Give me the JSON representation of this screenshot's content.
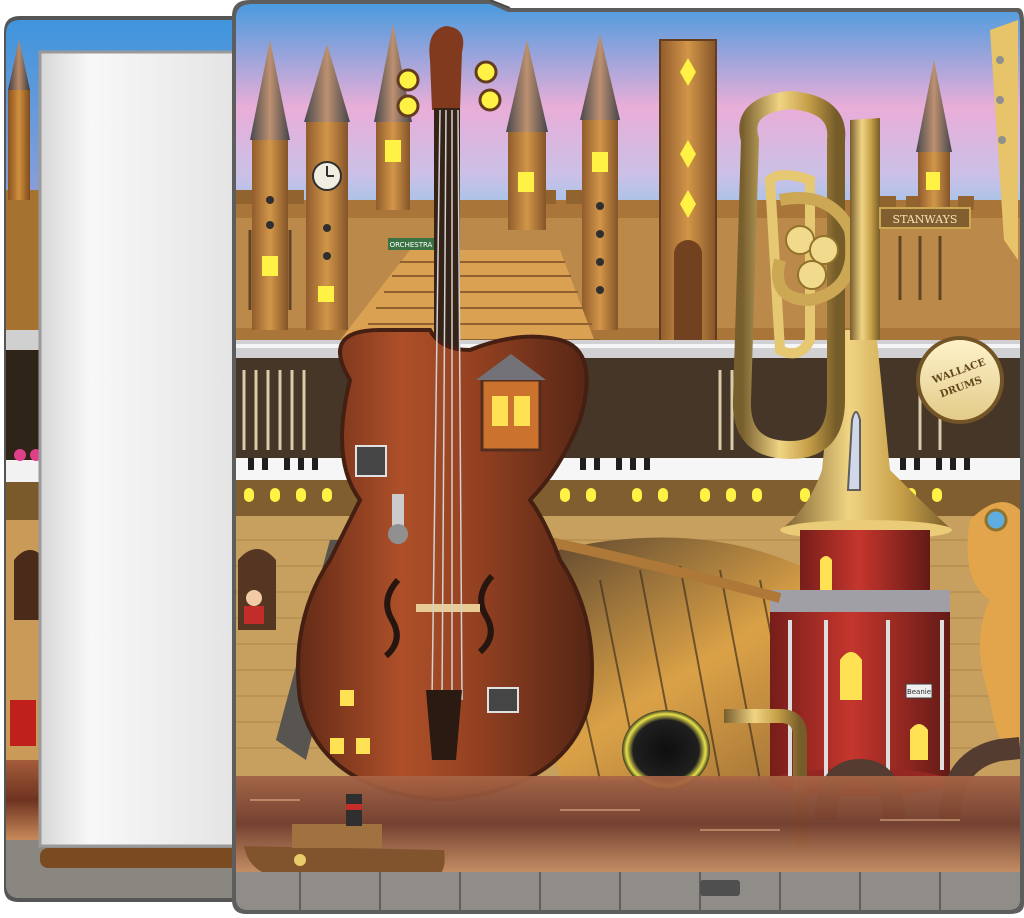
{
  "product": {
    "subject": "tablet skin mockup showing front and back views"
  },
  "artwork": {
    "texts": {
      "orchestra_sign": "ORCHESTRA",
      "piano_brand": "STANWAYS",
      "drum_line1": "WALLACE",
      "drum_line2": "DRUMS",
      "lighthouse_plaque": "Beanie"
    }
  },
  "colors": {
    "sky_top": "#4b9fe0",
    "sky_pink": "#e7a6d2",
    "sky_low": "#7cc3e8",
    "violin": "#8a3414",
    "violin_dark": "#4d1a07",
    "brass": "#c9a24a",
    "lighthouse_red": "#b3231c",
    "water": "#7a3b26",
    "stone": "#c49a55",
    "tower": "#b5762d",
    "frame": "#606060",
    "screen": "#f2f2f2"
  }
}
